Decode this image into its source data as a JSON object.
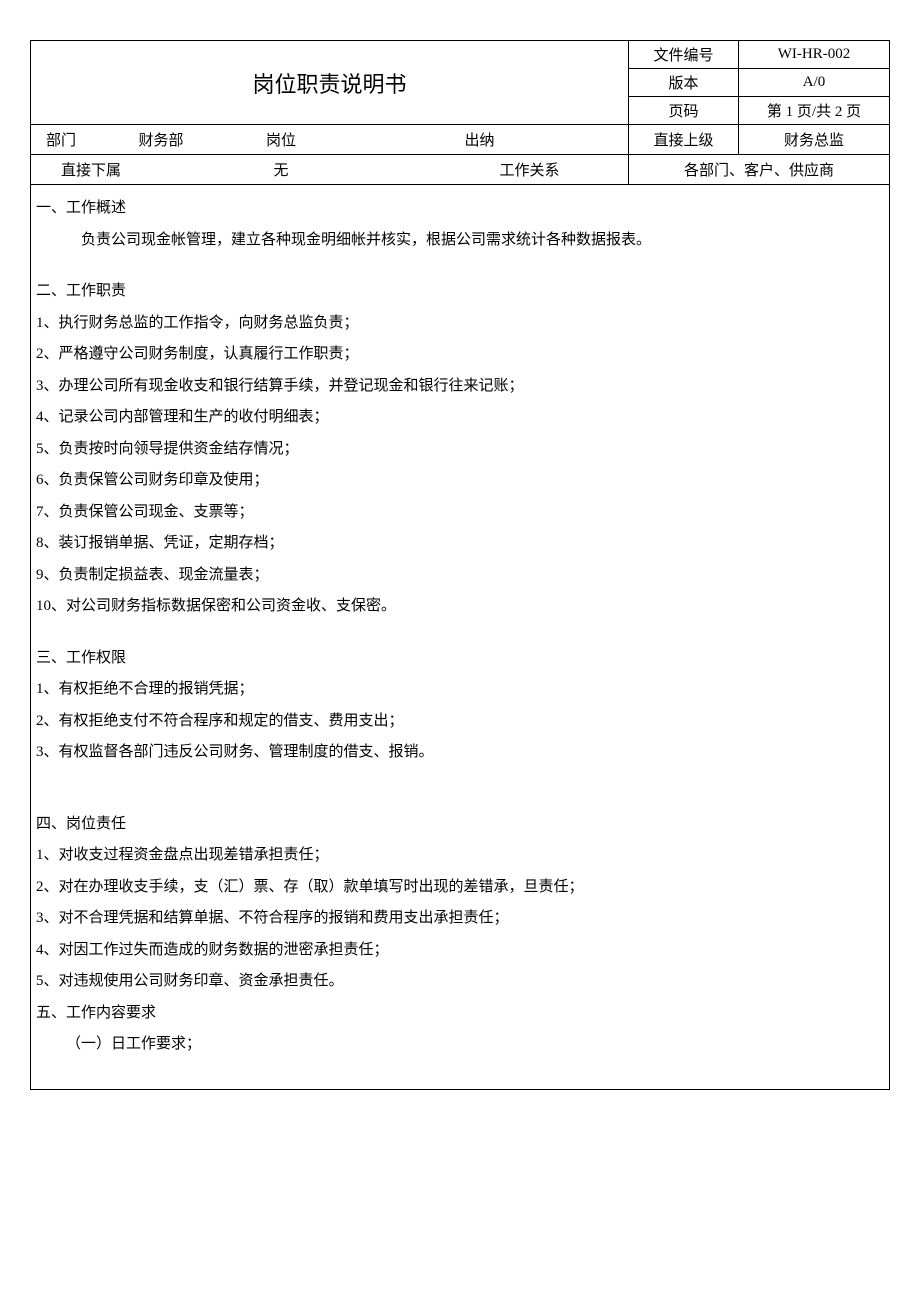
{
  "header": {
    "title": "岗位职责说明书",
    "doc_no_label": "文件编号",
    "doc_no": "WI-HR-002",
    "version_label": "版本",
    "version": "A/0",
    "page_label": "页码",
    "page": "第 1 页/共 2 页"
  },
  "info": {
    "dept_label": "部门",
    "dept": "财务部",
    "position_label": "岗位",
    "position": "出纳",
    "supervisor_label": "直接上级",
    "supervisor": "财务总监",
    "subordinate_label": "直接下属",
    "subordinate": "无",
    "relation_label": "工作关系",
    "relation": "各部门、客户、供应商"
  },
  "sections": {
    "s1": {
      "title": "一、工作概述",
      "text": "负责公司现金帐管理，建立各种现金明细帐并核实，根据公司需求统计各种数据报表。"
    },
    "s2": {
      "title": "二、工作职责",
      "items": [
        "1、执行财务总监的工作指令，向财务总监负责；",
        "2、严格遵守公司财务制度，认真履行工作职责；",
        "3、办理公司所有现金收支和银行结算手续，并登记现金和银行往来记账；",
        "4、记录公司内部管理和生产的收付明细表；",
        "5、负责按时向领导提供资金结存情况；",
        "6、负责保管公司财务印章及使用；",
        "7、负责保管公司现金、支票等；",
        "8、装订报销单据、凭证，定期存档；",
        "9、负责制定损益表、现金流量表；",
        "10、对公司财务指标数据保密和公司资金收、支保密。"
      ]
    },
    "s3": {
      "title": "三、工作权限",
      "items": [
        "1、有权拒绝不合理的报销凭据；",
        "2、有权拒绝支付不符合程序和规定的借支、费用支出；",
        "3、有权监督各部门违反公司财务、管理制度的借支、报销。"
      ]
    },
    "s4": {
      "title": "四、岗位责任",
      "items": [
        "1、对收支过程资金盘点出现差错承担责任；",
        "2、对在办理收支手续，支（汇）票、存（取）款单填写时出现的差错承，旦责任；",
        "3、对不合理凭据和结算单据、不符合程序的报销和费用支出承担责任；",
        "4、对因工作过失而造成的财务数据的泄密承担责任；",
        "5、对违规使用公司财务印章、资金承担责任。"
      ]
    },
    "s5": {
      "title": "五、工作内容要求",
      "sub1": "（一）日工作要求；"
    }
  }
}
